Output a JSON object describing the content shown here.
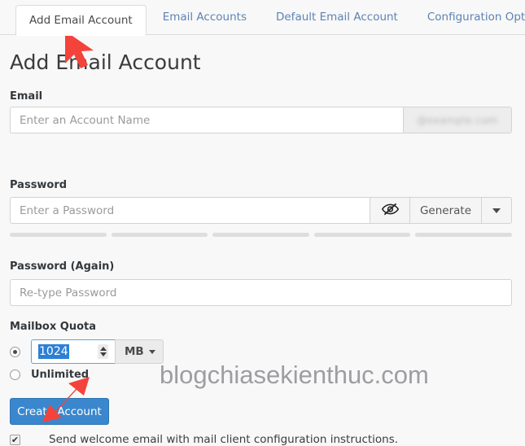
{
  "tabs": [
    {
      "label": "Add Email Account",
      "active": true
    },
    {
      "label": "Email Accounts",
      "active": false
    },
    {
      "label": "Default Email Account",
      "active": false
    },
    {
      "label": "Configuration Options",
      "active": false
    }
  ],
  "page": {
    "title": "Add Email Account"
  },
  "email": {
    "label": "Email",
    "value": "",
    "placeholder": "Enter an Account Name",
    "domain_suffix": "@example.com"
  },
  "password": {
    "label": "Password",
    "value": "",
    "placeholder": "Enter a Password",
    "toggle_icon": "eye-slash-icon",
    "generate_label": "Generate",
    "dropdown_icon": "caret-down-icon",
    "strength_segments": 5,
    "strength_filled": 0,
    "strength_color": "#dedede"
  },
  "password_again": {
    "label": "Password (Again)",
    "value": "",
    "placeholder": "Re-type Password"
  },
  "mailbox_quota": {
    "label": "Mailbox Quota",
    "selected": "fixed",
    "value": "1024",
    "value_selected": true,
    "unit": "MB",
    "unit_caret_icon": "caret-down-icon",
    "spinner_icon": "spinner-updown-icon",
    "unlimited_label": "Unlimited"
  },
  "actions": {
    "create_label": "Create Account",
    "create_color": "#3a87cd"
  },
  "welcome": {
    "checked": true,
    "check_glyph": "✔",
    "label": "Send welcome email with mail client configuration instructions."
  },
  "watermark": {
    "text": "blogchiasekienthuc.com"
  },
  "annotations": {
    "arrow_color": "#f4433a",
    "arrow_top_target": "Add Email Account tab",
    "arrow_bottom_target": "Create Account button"
  }
}
